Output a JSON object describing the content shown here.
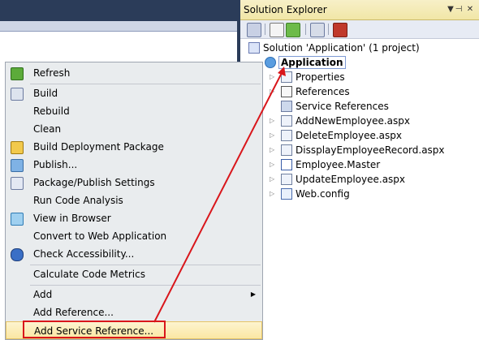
{
  "solution_explorer": {
    "title": "Solution Explorer",
    "title_buttons": [
      "pin-icon",
      "close-icon",
      "dropdown-icon"
    ],
    "solution_label": "Solution 'Application' (1 project)",
    "project_label": "Application",
    "items": [
      {
        "label": "Properties",
        "icon": "properties-icon"
      },
      {
        "label": "References",
        "icon": "references-icon"
      },
      {
        "label": "Service References",
        "icon": "folder-icon"
      },
      {
        "label": "AddNewEmployee.aspx",
        "icon": "aspx-file-icon"
      },
      {
        "label": "DeleteEmployee.aspx",
        "icon": "aspx-file-icon"
      },
      {
        "label": "DissplayEmployeeRecord.aspx",
        "icon": "aspx-file-icon"
      },
      {
        "label": "Employee.Master",
        "icon": "master-file-icon"
      },
      {
        "label": "UpdateEmployee.aspx",
        "icon": "aspx-file-icon"
      },
      {
        "label": "Web.config",
        "icon": "config-file-icon"
      }
    ]
  },
  "context_menu": {
    "items": [
      {
        "label": "Refresh"
      },
      {
        "label": "Build"
      },
      {
        "label": "Rebuild"
      },
      {
        "label": "Clean"
      },
      {
        "label": "Build Deployment Package"
      },
      {
        "label": "Publish..."
      },
      {
        "label": "Package/Publish Settings"
      },
      {
        "label": "Run Code Analysis"
      },
      {
        "label": "View in Browser"
      },
      {
        "label": "Convert to Web Application"
      },
      {
        "label": "Check Accessibility..."
      },
      {
        "label": "Calculate Code Metrics"
      },
      {
        "label": "Add"
      },
      {
        "label": "Add Reference..."
      },
      {
        "label": "Add Service Reference..."
      }
    ]
  },
  "colors": {
    "highlight_box": "#d9161b",
    "arrow": "#d9161b"
  }
}
